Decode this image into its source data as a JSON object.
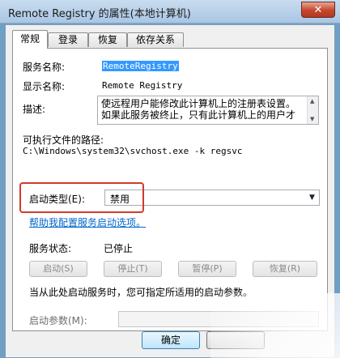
{
  "window": {
    "title": "Remote Registry 的属性(本地计算机)",
    "close_label": "✕"
  },
  "tabs": [
    {
      "label": "常规",
      "active": true
    },
    {
      "label": "登录",
      "active": false
    },
    {
      "label": "恢复",
      "active": false
    },
    {
      "label": "依存关系",
      "active": false
    }
  ],
  "general": {
    "service_name_label": "服务名称:",
    "service_name_value": "RemoteRegistry",
    "display_name_label": "显示名称:",
    "display_name_value": "Remote Registry",
    "description_label": "描述:",
    "description_value": "使远程用户能修改此计算机上的注册表设置。如果此服务被终止，只有此计算机上的用户才",
    "exe_path_label": "可执行文件的路径:",
    "exe_path_value": "C:\\Windows\\system32\\svchost.exe -k regsvc",
    "startup_type_label": "启动类型(E):",
    "startup_type_value": "禁用",
    "help_link": "帮助我配置服务启动选项。",
    "service_status_label": "服务状态:",
    "service_status_value": "已停止",
    "start_button": "启动(S)",
    "stop_button": "停止(T)",
    "pause_button": "暂停(P)",
    "resume_button": "恢复(R)",
    "start_hint": "当从此处启动服务时，您可指定所适用的启动参数。",
    "start_params_label": "启动参数(M):",
    "start_params_value": ""
  },
  "footer": {
    "ok_button": "确定"
  },
  "colors": {
    "highlight_box": "#d23a2a",
    "link": "#0066cc",
    "selection": "#3399ff"
  }
}
